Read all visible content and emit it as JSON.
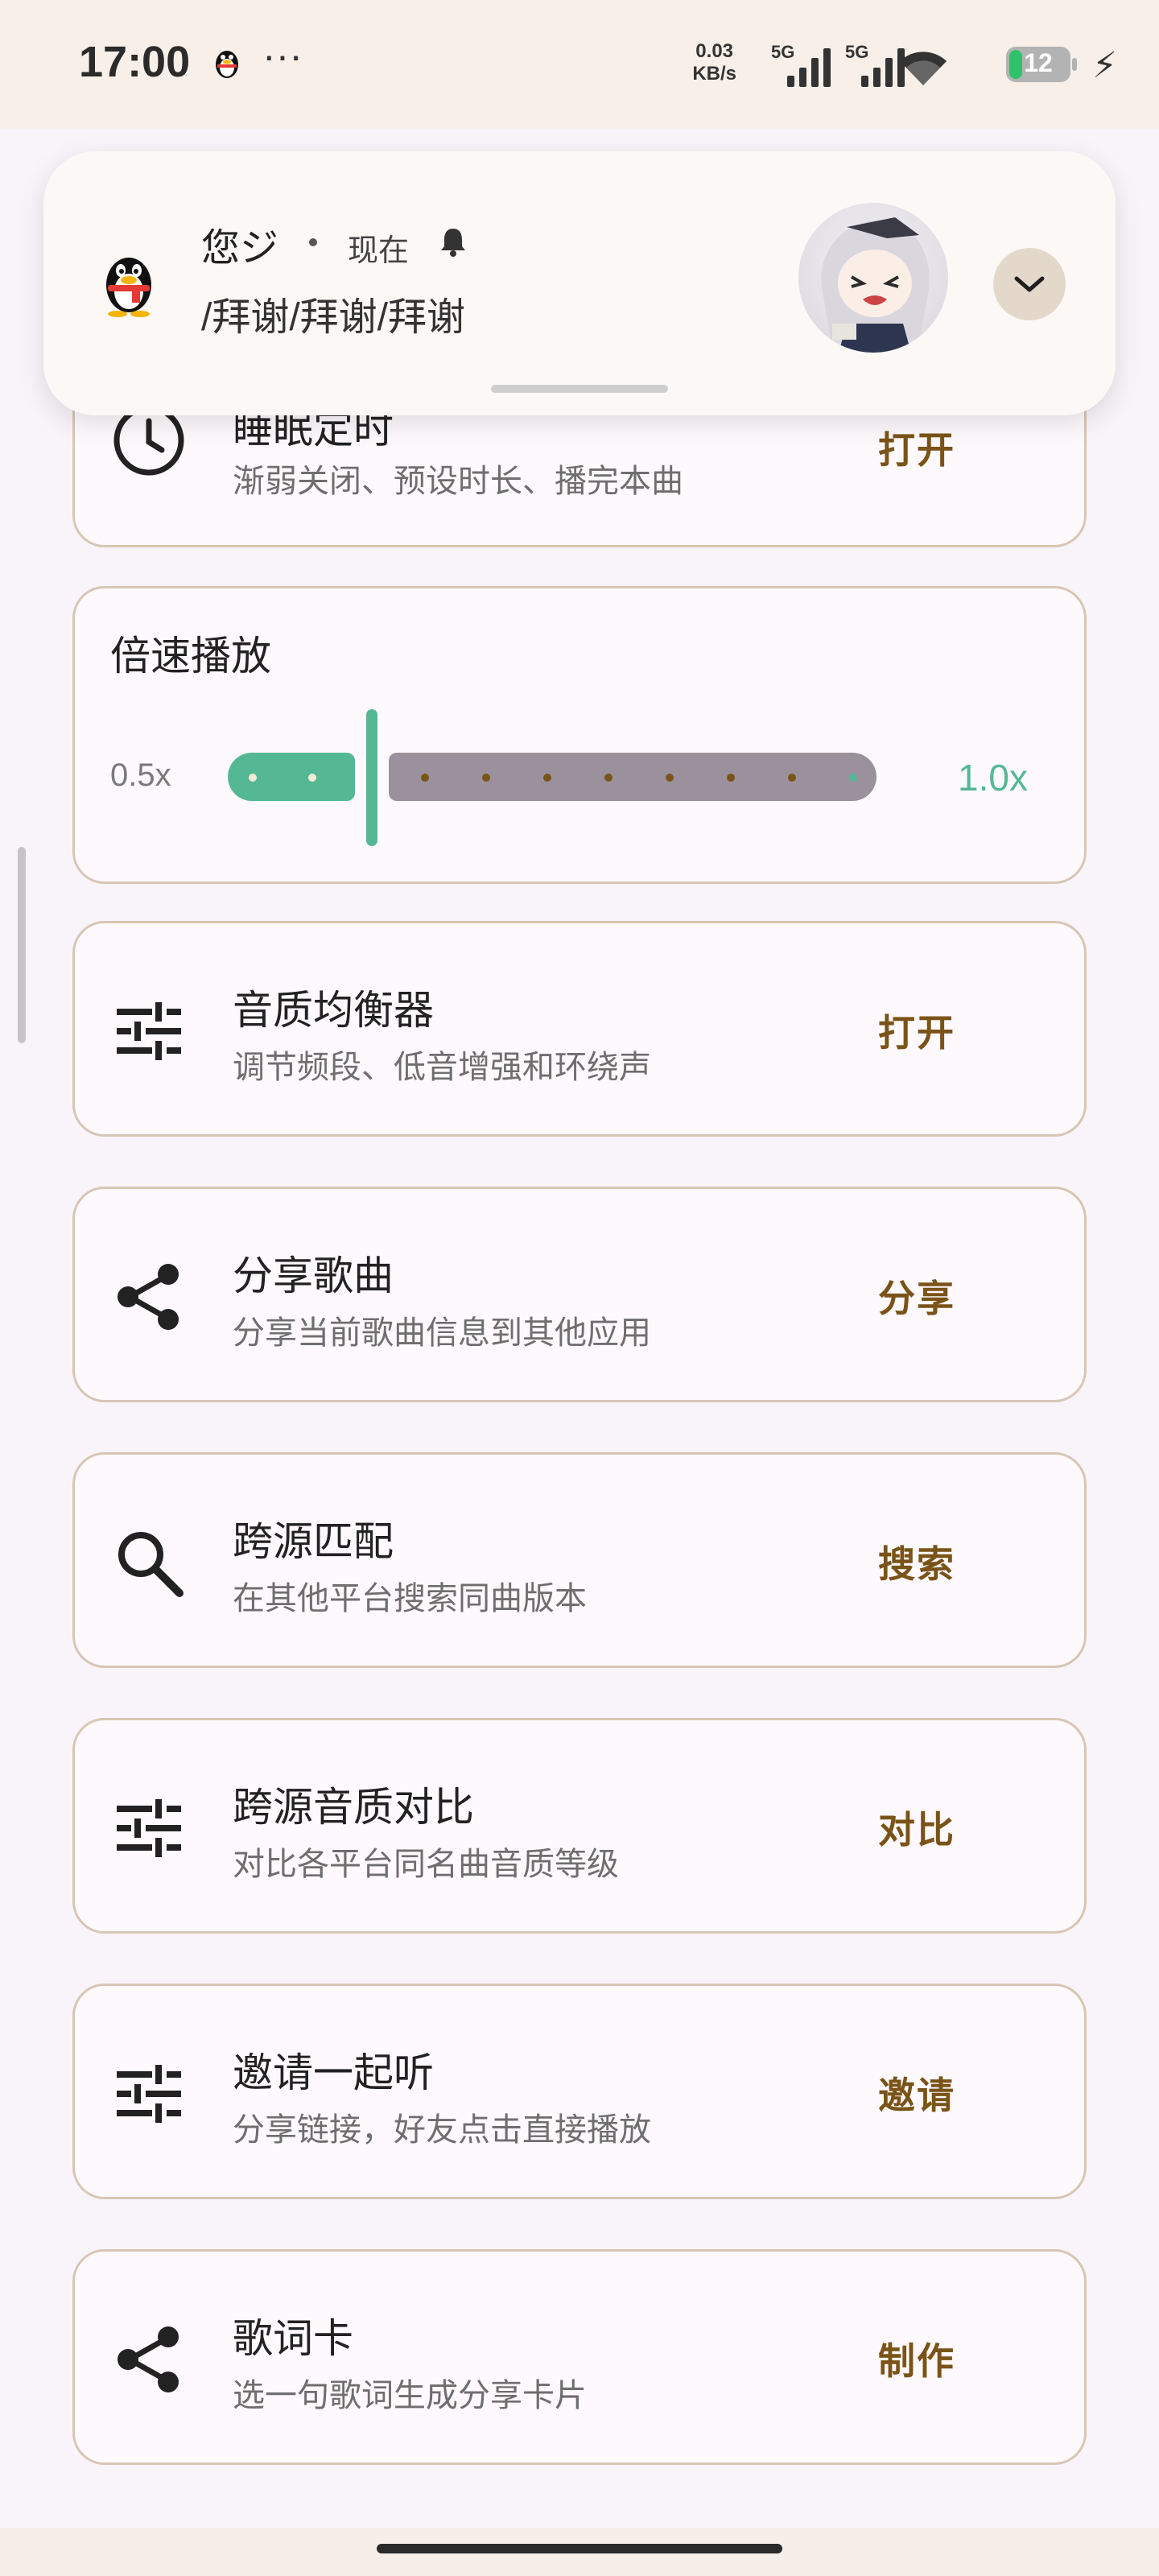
{
  "status_bar": {
    "time": "17:00",
    "more": "···",
    "net_speed_value": "0.03",
    "net_speed_unit": "KB/s",
    "signal1_label": "5G",
    "signal2_label": "5G",
    "battery": "12"
  },
  "notification": {
    "sender": "您ジ",
    "time": "现在",
    "message": "/拜谢/拜谢/拜谢"
  },
  "cards": {
    "sleep": {
      "title": "睡眠定时",
      "subtitle": "渐弱关闭、预设时长、播完本曲",
      "action": "打开"
    },
    "speed": {
      "title": "倍速播放",
      "min_label": "0.5x",
      "value_label": "1.0x",
      "value_fraction": 0.22
    },
    "equalizer": {
      "title": "音质均衡器",
      "subtitle": "调节频段、低音增强和环绕声",
      "action": "打开"
    },
    "share": {
      "title": "分享歌曲",
      "subtitle": "分享当前歌曲信息到其他应用",
      "action": "分享"
    },
    "match": {
      "title": "跨源匹配",
      "subtitle": "在其他平台搜索同曲版本",
      "action": "搜索"
    },
    "compare": {
      "title": "跨源音质对比",
      "subtitle": "对比各平台同名曲音质等级",
      "action": "对比"
    },
    "listen": {
      "title": "邀请一起听",
      "subtitle": "分享链接，好友点击直接播放",
      "action": "邀请"
    },
    "lyric_card": {
      "title": "歌词卡",
      "subtitle": "选一句歌词生成分享卡片",
      "action": "制作"
    }
  },
  "colors": {
    "accent": "#55b894",
    "action_text": "#7a5318",
    "border": "#d8c6b4"
  }
}
